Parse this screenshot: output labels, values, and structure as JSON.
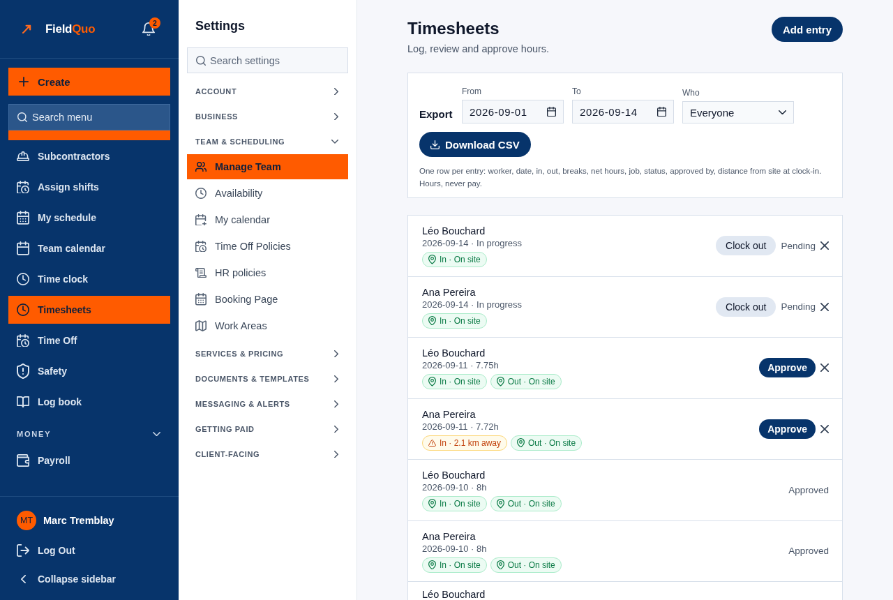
{
  "sidebar": {
    "logo": {
      "parts": [
        "Field",
        "Quo"
      ]
    },
    "notifications": {
      "count": "2"
    },
    "create_button": "Create",
    "search": {
      "placeholder": "Search menu"
    },
    "items": [
      {
        "label": "Subcontractors",
        "selected": false
      },
      {
        "label": "Assign shifts",
        "selected": false
      },
      {
        "label": "My schedule",
        "selected": false
      },
      {
        "label": "Team calendar",
        "selected": false
      },
      {
        "label": "Time clock",
        "selected": false
      },
      {
        "label": "Timesheets",
        "selected": true
      },
      {
        "label": "Time Off",
        "selected": false
      },
      {
        "label": "Safety",
        "selected": false
      },
      {
        "label": "Log book",
        "selected": false
      }
    ],
    "sections": [
      {
        "title": "MONEY",
        "expanded": true,
        "items": [
          {
            "label": "Payroll",
            "selected": false
          }
        ]
      }
    ],
    "user": {
      "initials": "MT",
      "name": "Marc Tremblay"
    },
    "footer_actions": [
      {
        "kind": "logout",
        "label": "Log Out"
      },
      {
        "kind": "collapse",
        "label": "Collapse sidebar"
      }
    ]
  },
  "settings": {
    "title": "Settings",
    "search": {
      "placeholder": "Search settings"
    },
    "sections": [
      {
        "title": "ACCOUNT",
        "expanded": false
      },
      {
        "title": "BUSINESS",
        "expanded": false
      },
      {
        "title": "TEAM & SCHEDULING",
        "expanded": true,
        "items": [
          {
            "label": "Manage Team",
            "selected": true
          },
          {
            "label": "Availability",
            "selected": false
          },
          {
            "label": "My calendar",
            "selected": false
          },
          {
            "label": "Time Off Policies",
            "selected": false
          },
          {
            "label": "HR policies",
            "selected": false
          },
          {
            "label": "Booking Page",
            "selected": false
          },
          {
            "label": "Work Areas",
            "selected": false
          }
        ]
      },
      {
        "title": "SERVICES & PRICING",
        "expanded": false
      },
      {
        "title": "DOCUMENTS & TEMPLATES",
        "expanded": false
      },
      {
        "title": "MESSAGING & ALERTS",
        "expanded": false
      },
      {
        "title": "GETTING PAID",
        "expanded": false
      },
      {
        "title": "CLIENT-FACING",
        "expanded": false
      }
    ]
  },
  "main": {
    "title": "Timesheets",
    "subtitle": "Log, review and approve hours.",
    "add_button": "Add entry",
    "export": {
      "label": "Export",
      "fields": [
        {
          "kind": "date",
          "label": "From",
          "value": "2026-09-01"
        },
        {
          "kind": "date",
          "label": "To",
          "value": "2026-09-14"
        },
        {
          "kind": "select",
          "label": "Who",
          "value": "Everyone"
        }
      ],
      "button": "Download CSV",
      "note": "One row per entry: worker, date, in, out, breaks, net hours, job, status, approved by, distance from site at clock-in. Hours, never pay."
    },
    "entries": [
      {
        "name": "Léo Bouchard",
        "meta": "2026-09-14 · In progress",
        "tags": [
          {
            "kind": "ok",
            "text": "In · On site"
          }
        ],
        "button": {
          "kind": "clock_out",
          "label": "Clock out"
        },
        "status": "Pending",
        "dismissible": true
      },
      {
        "name": "Ana Pereira",
        "meta": "2026-09-14 · In progress",
        "tags": [
          {
            "kind": "ok",
            "text": "In · On site"
          }
        ],
        "button": {
          "kind": "clock_out",
          "label": "Clock out"
        },
        "status": "Pending",
        "dismissible": true
      },
      {
        "name": "Léo Bouchard",
        "meta": "2026-09-11 · 7.75h",
        "tags": [
          {
            "kind": "ok",
            "text": "In · On site"
          },
          {
            "kind": "ok",
            "text": "Out · On site"
          }
        ],
        "button": {
          "kind": "approve",
          "label": "Approve"
        },
        "dismissible": true
      },
      {
        "name": "Ana Pereira",
        "meta": "2026-09-11 · 7.72h",
        "tags": [
          {
            "kind": "warn",
            "text": "In · 2.1 km away"
          },
          {
            "kind": "ok",
            "text": "Out · On site"
          }
        ],
        "button": {
          "kind": "approve",
          "label": "Approve"
        },
        "dismissible": true
      },
      {
        "name": "Léo Bouchard",
        "meta": "2026-09-10 · 8h",
        "tags": [
          {
            "kind": "ok",
            "text": "In · On site"
          },
          {
            "kind": "ok",
            "text": "Out · On site"
          }
        ],
        "status": "Approved",
        "dismissible": false
      },
      {
        "name": "Ana Pereira",
        "meta": "2026-09-10 · 8h",
        "tags": [
          {
            "kind": "ok",
            "text": "In · On site"
          },
          {
            "kind": "ok",
            "text": "Out · On site"
          }
        ],
        "status": "Approved",
        "dismissible": false
      },
      {
        "name": "Léo Bouchard"
      }
    ]
  }
}
